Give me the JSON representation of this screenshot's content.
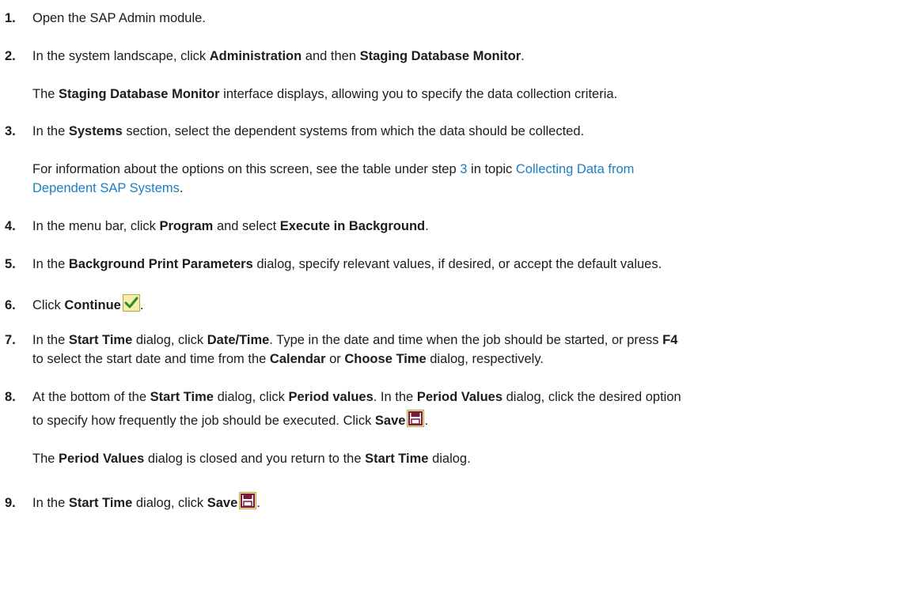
{
  "steps": [
    {
      "num": "1.",
      "text": "Open the SAP Admin module."
    },
    {
      "num": "2.",
      "a": "In the system landscape, click ",
      "b1": "Administration",
      "c": " and then ",
      "b2": "Staging Database Monitor",
      "d": "."
    },
    {
      "b1": "Staging Database Monitor",
      "a": " interface displays, allowing you to specify the data collection criteria.",
      "pre": "The "
    },
    {
      "num": "3.",
      "a": "In the ",
      "b1": "Systems",
      "c": " section, select the dependent systems from which the data should be collected."
    },
    {
      "a": "For information about the options on this screen, see the table under step ",
      "link1": "3",
      "c": " in topic ",
      "link2a": "Collecting Data from",
      "link2b": "Dependent SAP Systems",
      "d": "."
    },
    {
      "num": "4.",
      "a": "In the menu bar, click ",
      "b1": "Program",
      "c": " and select ",
      "b2": "Execute in Background",
      "d": "."
    },
    {
      "num": "5.",
      "a": "In the ",
      "b1": "Background Print Parameters",
      "c": " dialog, specify relevant values, if desired, or accept the default values."
    },
    {
      "num": "6.",
      "a": "Click ",
      "b1": "Continue",
      "d": "."
    },
    {
      "num": "7.",
      "a": "In the ",
      "b1": "Start Time",
      "c": " dialog, click ",
      "b2": "Date/Time",
      "e": ". Type in the date and time when the job should be started, or press ",
      "b3": "F4",
      "f": "to select the start date and time from the ",
      "b4": "Calendar",
      "g": " or ",
      "b5": "Choose Time",
      "h": " dialog, respectively."
    },
    {
      "num": "8.",
      "a": "At the bottom of the ",
      "b1": "Start Time",
      "c": " dialog, click ",
      "b2": "Period values",
      "e": ". In the ",
      "b3": "Period Values",
      "f": " dialog, click the desired option",
      "g": "to specify how frequently the job should be executed. Click ",
      "b4": "Save",
      "d": "."
    },
    {
      "pre": "The ",
      "b1": "Period Values",
      "a": " dialog is closed and you return to the ",
      "b2": "Start Time",
      "d": " dialog."
    },
    {
      "num": "9.",
      "a": "In the ",
      "b1": "Start Time",
      "c": " dialog, click ",
      "b2": "Save",
      "d": "."
    }
  ],
  "icons": {
    "continue": "checkmark-icon",
    "save": "save-icon"
  },
  "colors": {
    "text": "#1c1c1c",
    "link": "#1a7fc1"
  }
}
